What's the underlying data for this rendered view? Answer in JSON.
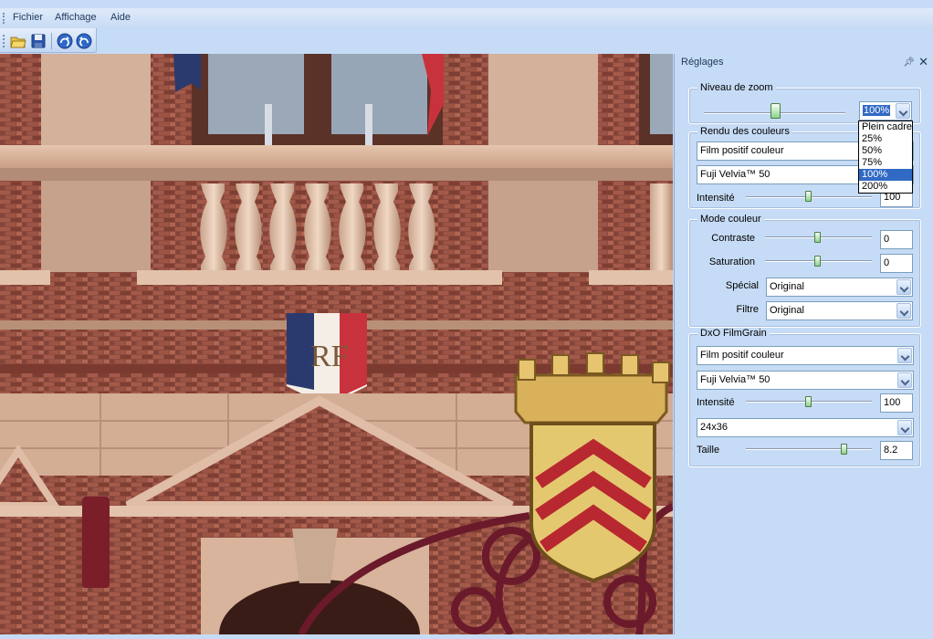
{
  "menu": {
    "items": [
      {
        "label": "Fichier"
      },
      {
        "label": "Affichage"
      },
      {
        "label": "Aide"
      }
    ]
  },
  "toolbar": {
    "buttons": [
      {
        "icon": "open-folder-icon"
      },
      {
        "icon": "save-disk-icon"
      },
      {
        "icon": "rotate-clockwise-icon"
      },
      {
        "icon": "rotate-counterclockwise-icon"
      }
    ]
  },
  "viewer": {
    "description_icon": "photo-image",
    "colors": {
      "brick": "#8c4a3c",
      "stone": "#d7b49c",
      "sky": "#9aa8b8",
      "flag_blue": "#2a3a6e",
      "flag_red": "#c8323c",
      "shield_gold": "#e4c870",
      "shield_red": "#b82830",
      "ironwork": "#6a1a2a"
    }
  },
  "panel": {
    "title": "Réglages",
    "zoom": {
      "label": "Niveau de zoom",
      "value": "100%",
      "slider_level": 0.5,
      "options": [
        "Plein cadre",
        "25%",
        "50%",
        "75%",
        "100%",
        "200%"
      ],
      "selected_index": 4
    },
    "rendering": {
      "label": "Rendu des couleurs",
      "type_value": "Film positif couleur",
      "film_value": "Fuji Velvia™ 50",
      "intensity_label": "Intensité",
      "intensity_value": "100",
      "intensity_level": 0.5
    },
    "color_mode": {
      "label": "Mode couleur",
      "contrast_label": "Contraste",
      "contrast_value": "0",
      "contrast_level": 0.5,
      "saturation_label": "Saturation",
      "saturation_value": "0",
      "saturation_level": 0.5,
      "special_label": "Spécial",
      "special_value": "Original",
      "filter_label": "Filtre",
      "filter_value": "Original"
    },
    "filmgrain": {
      "label": "DxO FilmGrain",
      "type_value": "Film positif couleur",
      "film_value": "Fuji Velvia™ 50",
      "intensity_label": "Intensité",
      "intensity_value": "100",
      "intensity_level": 0.5,
      "format_value": "24x36",
      "size_label": "Taille",
      "size_value": "8.2",
      "size_level": 0.8
    }
  }
}
